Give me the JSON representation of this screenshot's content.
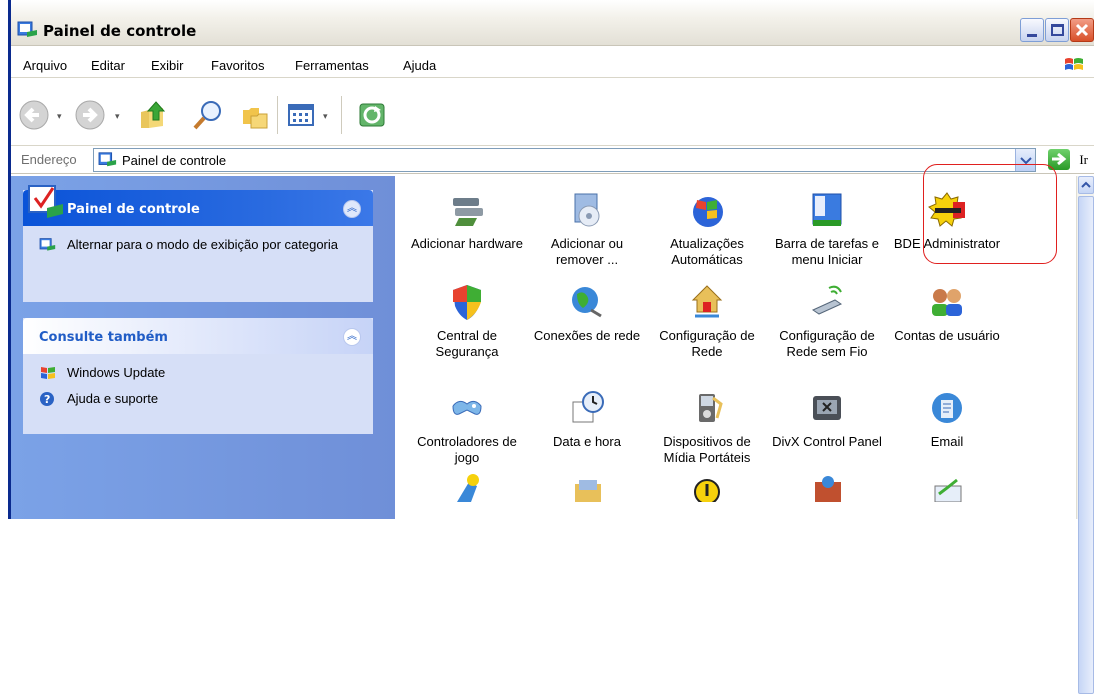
{
  "window": {
    "title": "Painel de controle"
  },
  "menubar": {
    "items": [
      "Arquivo",
      "Editar",
      "Exibir",
      "Favoritos",
      "Ferramentas",
      "Ajuda"
    ]
  },
  "address": {
    "label": "Endereço",
    "value": "Painel de controle",
    "go_label": "Ir"
  },
  "taskpane": {
    "panel1": {
      "title": "Painel de controle",
      "link": "Alternar para o modo de exibição por categoria"
    },
    "panel2": {
      "title": "Consulte também",
      "links": [
        "Windows Update",
        "Ajuda e suporte"
      ]
    }
  },
  "items": [
    {
      "label": "Adicionar hardware",
      "icon": "add-hardware-icon"
    },
    {
      "label": "Adicionar ou remover ...",
      "icon": "add-remove-programs-icon"
    },
    {
      "label": "Atualizações Automáticas",
      "icon": "automatic-updates-icon"
    },
    {
      "label": "Barra de tarefas e menu Iniciar",
      "icon": "taskbar-icon"
    },
    {
      "label": "BDE Administrator",
      "icon": "bde-administrator-icon"
    },
    {
      "label": "Central de Segurança",
      "icon": "security-center-icon"
    },
    {
      "label": "Conexões de rede",
      "icon": "network-connections-icon"
    },
    {
      "label": "Configuração de Rede",
      "icon": "network-setup-icon"
    },
    {
      "label": "Configuração de Rede sem Fio",
      "icon": "wireless-setup-icon"
    },
    {
      "label": "Contas de usuário",
      "icon": "user-accounts-icon"
    },
    {
      "label": "Controladores de jogo",
      "icon": "game-controllers-icon"
    },
    {
      "label": "Data e hora",
      "icon": "date-time-icon"
    },
    {
      "label": "Dispositivos de Mídia Portáteis",
      "icon": "portable-media-icon"
    },
    {
      "label": "DivX Control Panel",
      "icon": "divx-icon"
    },
    {
      "label": "Email",
      "icon": "email-icon"
    }
  ],
  "colors": {
    "highlight": "#e0201f",
    "taskpane": "#6f8fd8",
    "titlebar": "#e3e0d6"
  }
}
